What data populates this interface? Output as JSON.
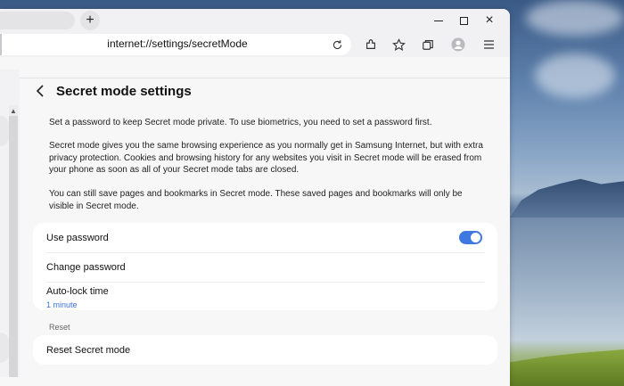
{
  "browser": {
    "new_tab_label": "+",
    "address": "internet://settings/secretMode",
    "window_controls": {
      "minimize": "minimize-icon",
      "maximize": "maximize-icon",
      "close": "×"
    },
    "toolbar_icons": [
      "extensions-icon",
      "bookmark-star-icon",
      "tabs-icon",
      "profile-icon",
      "menu-icon"
    ]
  },
  "page": {
    "title": "Secret mode settings",
    "paragraphs": [
      "Set a password to keep Secret mode private. To use biometrics, you need to set a password first.",
      "Secret mode gives you the same browsing experience as you normally get in Samsung Internet, but with extra privacy protection. Cookies and browsing history for any websites you visit in Secret mode will be erased from your phone as soon as all of your Secret mode tabs are closed.",
      "You can still save pages and bookmarks in Secret mode. These saved pages and bookmarks will only be visible in Secret mode."
    ],
    "settings": {
      "use_password": {
        "label": "Use password",
        "enabled": true
      },
      "change_password": {
        "label": "Change password"
      },
      "auto_lock": {
        "label": "Auto-lock time",
        "value": "1 minute"
      }
    },
    "reset_section": {
      "label": "Reset",
      "reset_item": "Reset Secret mode"
    }
  },
  "colors": {
    "accent": "#3e78e0",
    "link": "#3b72d9"
  }
}
